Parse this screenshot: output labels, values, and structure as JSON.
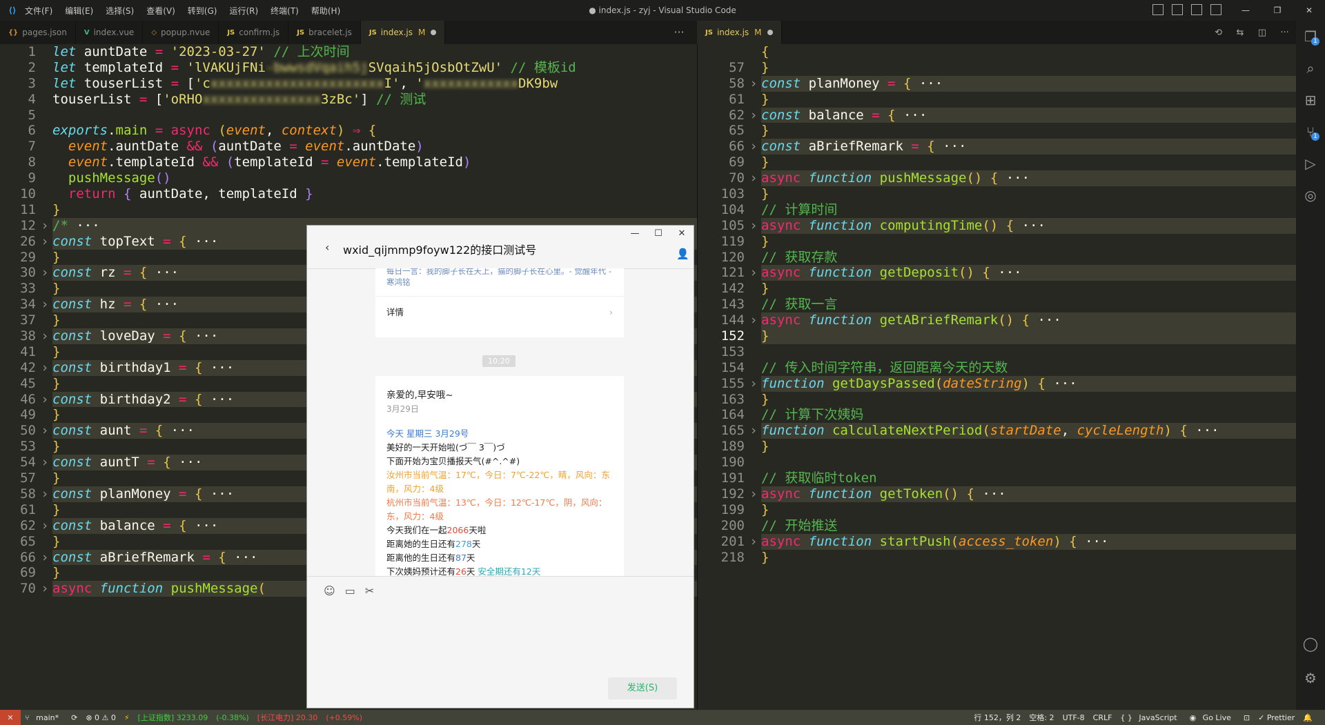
{
  "window": {
    "title": "● index.js - zyj - Visual Studio Code",
    "menu": [
      "文件(F)",
      "编辑(E)",
      "选择(S)",
      "查看(V)",
      "转到(G)",
      "运行(R)",
      "终端(T)",
      "帮助(H)"
    ]
  },
  "left_tabs": [
    {
      "icon": "{}",
      "label": "pages.json",
      "active": false
    },
    {
      "icon": "V",
      "label": "index.vue",
      "active": false
    },
    {
      "icon": "◇",
      "label": "popup.nvue",
      "active": false
    },
    {
      "icon": "JS",
      "label": "confirm.js",
      "active": false
    },
    {
      "icon": "JS",
      "label": "bracelet.js",
      "active": false
    },
    {
      "icon": "JS",
      "label": "index.js",
      "active": true,
      "mod": "M"
    }
  ],
  "right_tabs": [
    {
      "icon": "JS",
      "label": "index.js",
      "active": true,
      "mod": "M"
    }
  ],
  "left_code": [
    {
      "n": "1",
      "h": "<span class='k'>let</span> auntDate <span class='kp'>=</span> <span class='s'>'2023-03-27'</span> <span class='c'>// 上次时间</span>"
    },
    {
      "n": "2",
      "h": "<span class='k'>let</span> templateId <span class='kp'>=</span> <span class='s'>'lVAKUjFNi<span class=\"blur\">-bwwsdVqaih5j</span>SVqaih5jOsbOtZwU'</span> <span class='c'>// 模板id</span>"
    },
    {
      "n": "3",
      "h": "<span class='k'>let</span> touserList <span class='kp'>=</span> [<span class='s'>'c<span class=\"blur\">xxxxxxxxxxxxxxxxxxxxxx</span>I'</span>, <span class='s'>'<span class=\"blur\">xxxxxxxxxxxx</span>DK9bw</span>"
    },
    {
      "n": "4",
      "h": "touserList <span class='kp'>=</span> [<span class='s'>'oRHO<span class=\"blur\">xxxxxxxxxxxxxxx</span>3zBc'</span>] <span class='c'>// 测试</span>"
    },
    {
      "n": "5",
      "h": ""
    },
    {
      "n": "6",
      "h": "<span class='k'>exports</span>.<span class='f'>main</span> <span class='kp'>=</span> <span class='kp'>async</span> <span class='b'>(</span><span class='p'>event</span>, <span class='p'>context</span><span class='b'>)</span> <span class='kp'>⇒</span> <span class='b'>{</span>"
    },
    {
      "n": "7",
      "h": "  <span class='p'>event</span>.auntDate <span class='kp'>&&</span> <span class='m'>(</span>auntDate <span class='kp'>=</span> <span class='p'>event</span>.auntDate<span class='m'>)</span>"
    },
    {
      "n": "8",
      "h": "  <span class='p'>event</span>.templateId <span class='kp'>&&</span> <span class='m'>(</span>templateId <span class='kp'>=</span> <span class='p'>event</span>.templateId<span class='m'>)</span>"
    },
    {
      "n": "9",
      "h": "  <span class='f'>pushMessage</span><span class='m'>()</span>"
    },
    {
      "n": "10",
      "h": "  <span class='kp'>return</span> <span class='m'>{</span> auntDate, templateId <span class='m'>}</span>"
    },
    {
      "n": "11",
      "h": "<span class='b'>}</span>"
    },
    {
      "n": "12",
      "fold": true,
      "h": "<span class='c'>/*</span> ···"
    },
    {
      "n": "26",
      "fold": true,
      "h": "<span class='k'>const</span> topText <span class='kp'>=</span> <span class='b'>{</span> ···"
    },
    {
      "n": "29",
      "h": "<span class='b'>}</span>"
    },
    {
      "n": "30",
      "fold": true,
      "h": "<span class='k'>const</span> rz <span class='kp'>=</span> <span class='b'>{</span> ···"
    },
    {
      "n": "33",
      "h": "<span class='b'>}</span>"
    },
    {
      "n": "34",
      "fold": true,
      "h": "<span class='k'>const</span> hz <span class='kp'>=</span> <span class='b'>{</span> ···"
    },
    {
      "n": "37",
      "h": "<span class='b'>}</span>"
    },
    {
      "n": "38",
      "fold": true,
      "h": "<span class='k'>const</span> loveDay <span class='kp'>=</span> <span class='b'>{</span> ···"
    },
    {
      "n": "41",
      "h": "<span class='b'>}</span>"
    },
    {
      "n": "42",
      "fold": true,
      "h": "<span class='k'>const</span> birthday1 <span class='kp'>=</span> <span class='b'>{</span> ···"
    },
    {
      "n": "45",
      "h": "<span class='b'>}</span>"
    },
    {
      "n": "46",
      "fold": true,
      "h": "<span class='k'>const</span> birthday2 <span class='kp'>=</span> <span class='b'>{</span> ···"
    },
    {
      "n": "49",
      "h": "<span class='b'>}</span>"
    },
    {
      "n": "50",
      "fold": true,
      "h": "<span class='k'>const</span> aunt <span class='kp'>=</span> <span class='b'>{</span> ···"
    },
    {
      "n": "53",
      "h": "<span class='b'>}</span>"
    },
    {
      "n": "54",
      "fold": true,
      "h": "<span class='k'>const</span> auntT <span class='kp'>=</span> <span class='b'>{</span> ···"
    },
    {
      "n": "57",
      "h": "<span class='b'>}</span>"
    },
    {
      "n": "58",
      "fold": true,
      "h": "<span class='k'>const</span> planMoney <span class='kp'>=</span> <span class='b'>{</span> ···"
    },
    {
      "n": "61",
      "h": "<span class='b'>}</span>"
    },
    {
      "n": "62",
      "fold": true,
      "h": "<span class='k'>const</span> balance <span class='kp'>=</span> <span class='b'>{</span> ···"
    },
    {
      "n": "65",
      "h": "<span class='b'>}</span>"
    },
    {
      "n": "66",
      "fold": true,
      "h": "<span class='k'>const</span> aBriefRemark <span class='kp'>=</span> <span class='b'>{</span> ···"
    },
    {
      "n": "69",
      "h": "<span class='b'>}</span>"
    },
    {
      "n": "70",
      "fold": true,
      "h": "<span class='kp'>async</span> <span class='k'>function</span> <span class='f'>pushMessage</span><span class='b'>(</span>"
    }
  ],
  "right_code": [
    {
      "n": "",
      "h": "<span class='b'>{</span>"
    },
    {
      "n": "57",
      "h": "<span class='b'>}</span>"
    },
    {
      "n": "58",
      "fold": true,
      "h": "<span class='k'>const</span> planMoney <span class='kp'>=</span> <span class='b'>{</span> ···"
    },
    {
      "n": "61",
      "h": "<span class='b'>}</span>"
    },
    {
      "n": "62",
      "fold": true,
      "h": "<span class='k'>const</span> balance <span class='kp'>=</span> <span class='b'>{</span> ···"
    },
    {
      "n": "65",
      "h": "<span class='b'>}</span>"
    },
    {
      "n": "66",
      "fold": true,
      "h": "<span class='k'>const</span> aBriefRemark <span class='kp'>=</span> <span class='b'>{</span> ···"
    },
    {
      "n": "69",
      "h": "<span class='b'>}</span>"
    },
    {
      "n": "70",
      "fold": true,
      "h": "<span class='kp'>async</span> <span class='k'>function</span> <span class='f'>pushMessage</span><span class='b'>()</span> <span class='b'>{</span> ···"
    },
    {
      "n": "103",
      "h": "<span class='b'>}</span>"
    },
    {
      "n": "104",
      "h": "<span class='c'>// 计算时间</span>"
    },
    {
      "n": "105",
      "fold": true,
      "h": "<span class='kp'>async</span> <span class='k'>function</span> <span class='f'>computingTime</span><span class='b'>()</span> <span class='b'>{</span> ···"
    },
    {
      "n": "119",
      "h": "<span class='b'>}</span>"
    },
    {
      "n": "120",
      "h": "<span class='c'>// 获取存款</span>"
    },
    {
      "n": "121",
      "fold": true,
      "h": "<span class='kp'>async</span> <span class='k'>function</span> <span class='f'>getDeposit</span><span class='b'>()</span> <span class='b'>{</span> ···"
    },
    {
      "n": "142",
      "h": "<span class='b'>}</span>"
    },
    {
      "n": "143",
      "h": "<span class='c'>// 获取一言</span>"
    },
    {
      "n": "144",
      "fold": true,
      "h": "<span class='kp'>async</span> <span class='k'>function</span> <span class='f'>getABriefRemark</span><span class='b'>()</span> <span class='b'>{</span> ···"
    },
    {
      "n": "152",
      "cur": true,
      "h": "<span class='b'>}</span>"
    },
    {
      "n": "153",
      "h": ""
    },
    {
      "n": "154",
      "h": "<span class='c'>// 传入时间字符串，返回距离今天的天数</span>"
    },
    {
      "n": "155",
      "fold": true,
      "h": "<span class='k'>function</span> <span class='f'>getDaysPassed</span><span class='b'>(</span><span class='p'>dateString</span><span class='b'>)</span> <span class='b'>{</span> ···"
    },
    {
      "n": "163",
      "h": "<span class='b'>}</span>"
    },
    {
      "n": "164",
      "h": "<span class='c'>// 计算下次姨妈</span>"
    },
    {
      "n": "165",
      "fold": true,
      "h": "<span class='k'>function</span> <span class='f'>calculateNextPeriod</span><span class='b'>(</span><span class='p'>startDate</span>, <span class='p'>cycleLength</span><span class='b'>)</span> <span class='b'>{</span> ···"
    },
    {
      "n": "189",
      "h": "<span class='b'>}</span>"
    },
    {
      "n": "190",
      "h": ""
    },
    {
      "n": "191",
      "h": "<span class='c'>// 获取临时token</span>"
    },
    {
      "n": "192",
      "fold": true,
      "h": "<span class='kp'>async</span> <span class='k'>function</span> <span class='f'>getToken</span><span class='b'>()</span> <span class='b'>{</span> ···"
    },
    {
      "n": "199",
      "h": "<span class='b'>}</span>"
    },
    {
      "n": "200",
      "h": "<span class='c'>// 开始推送</span>"
    },
    {
      "n": "201",
      "fold": true,
      "h": "<span class='kp'>async</span> <span class='k'>function</span> <span class='f'>startPush</span><span class='b'>(</span><span class='p'>access_token</span><span class='b'>)</span> <span class='b'>{</span> ···"
    },
    {
      "n": "218",
      "h": "<span class='b'>}</span>"
    }
  ],
  "chat": {
    "title": "wxid_qijmmp9foyw122的接口测试号",
    "daily_text": "每日一言：我的脚子长在天上，猫的脚子长在心里。- 觉醒年代 - 寒鸿铭",
    "detail_label": "详情",
    "time": "10:20",
    "greeting": "亲爱的,早安哦~",
    "date": "3月29日",
    "today": "今天 星期三 3月29号",
    "good_day": "美好的一天开始啦(づ￣ 3￣)づ",
    "weather_intro": "下面开始为宝贝播报天气(#^.^#)",
    "weather_1": "汝州市当前气温：17℃，今日：7℃-22℃，晴，风向：东南，风力：4级",
    "weather_2": "杭州市当前气温：13℃，今日：12℃-17℃，阴，风向：东，风力：4级",
    "together_pre": "今天我们在一起",
    "together_days": "2066",
    "together_post": "天啦",
    "bday_her_pre": "距离她的生日还有",
    "bday_her_days": "278",
    "bday_her_post": "天",
    "bday_his_pre": "距离他的生日还有",
    "bday_his_days": "87",
    "bday_his_post": "天",
    "period_pre": "下次姨妈预计还有",
    "period_days": "26",
    "period_post": "天",
    "safe": "安全期还有12天",
    "send_label": "发送(S)"
  },
  "status": {
    "branch": "main*",
    "errors": "⊗ 0 ⚠ 0",
    "stock1": "[上证指数] 3233.09",
    "stock1_change": "(-0.38%)",
    "stock2": "[长江电力] 20.30",
    "stock2_change": "(+0.59%)",
    "position": "行 152，列 2",
    "spaces": "空格: 2",
    "encoding": "UTF-8",
    "eol": "CRLF",
    "language": "JavaScript",
    "golive": "Go Live",
    "prettier": "✓ Prettier"
  }
}
